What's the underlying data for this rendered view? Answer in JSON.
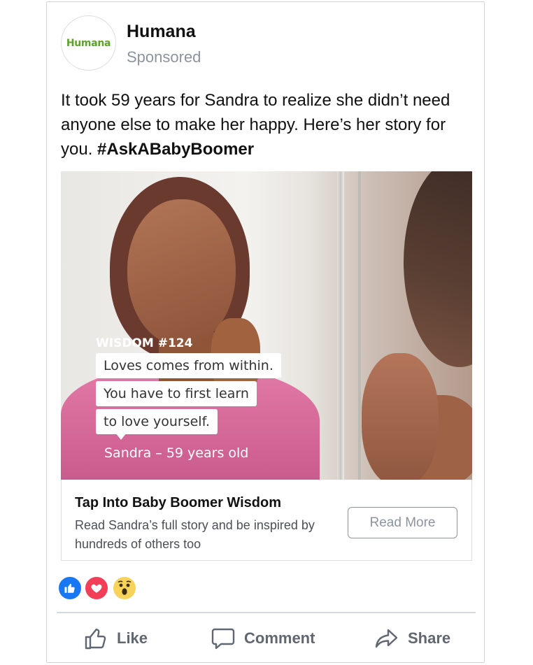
{
  "post": {
    "page_name": "Humana",
    "avatar_text": "Humana",
    "sponsored": "Sponsored",
    "text_main": "It took 59 years for Sandra to realize she didn’t need anyone else to make her happy. Here’s her story for you. ",
    "hashtag": "#AskABabyBoomer"
  },
  "image_overlay": {
    "wisdom_label": "WISDOM #124",
    "quote_lines": [
      "Loves comes from within.",
      "You have to first learn",
      "to love yourself."
    ],
    "author": "Sandra – 59 years old"
  },
  "link_preview": {
    "title": "Tap Into Baby Boomer Wisdom",
    "description": "Read Sandra’s full story and be inspired by hundreds of others too",
    "button": "Read More"
  },
  "reactions": [
    "like-icon",
    "love-icon",
    "wow-icon"
  ],
  "actions": {
    "like": "Like",
    "comment": "Comment",
    "share": "Share"
  },
  "colors": {
    "brand_green": "#5fa12a",
    "like_blue": "#1877f2",
    "love_red": "#f33e58",
    "wow_yellow": "#f7d35a",
    "action_gray": "#606770"
  }
}
